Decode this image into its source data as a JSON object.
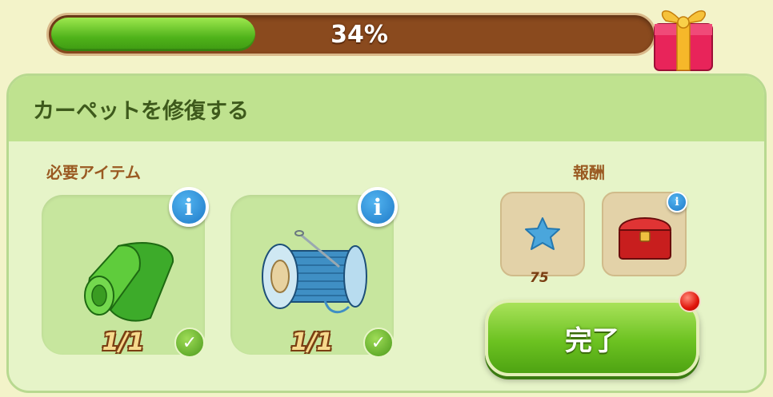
{
  "progress": {
    "label": "34%",
    "value": 0.34
  },
  "panel": {
    "title": "カーペットを修復する",
    "required_label": "必要アイテム",
    "reward_label": "報酬"
  },
  "required_items": [
    {
      "icon": "green-cloth-roll-icon",
      "count": "1/1",
      "complete": true
    },
    {
      "icon": "blue-thread-spool-icon",
      "count": "1/1",
      "complete": true
    }
  ],
  "rewards": [
    {
      "icon": "blue-star-icon",
      "count": "75"
    },
    {
      "icon": "red-chest-icon",
      "count": ""
    }
  ],
  "complete_button": {
    "label": "完了"
  },
  "colors": {
    "progress_fill": "#5fc220",
    "progress_track": "#8a4a1e",
    "panel_bg": "#e6f4c8",
    "header_bg": "#bfe28f",
    "button_green": "#6cc221",
    "notification_red": "#e0140a"
  }
}
